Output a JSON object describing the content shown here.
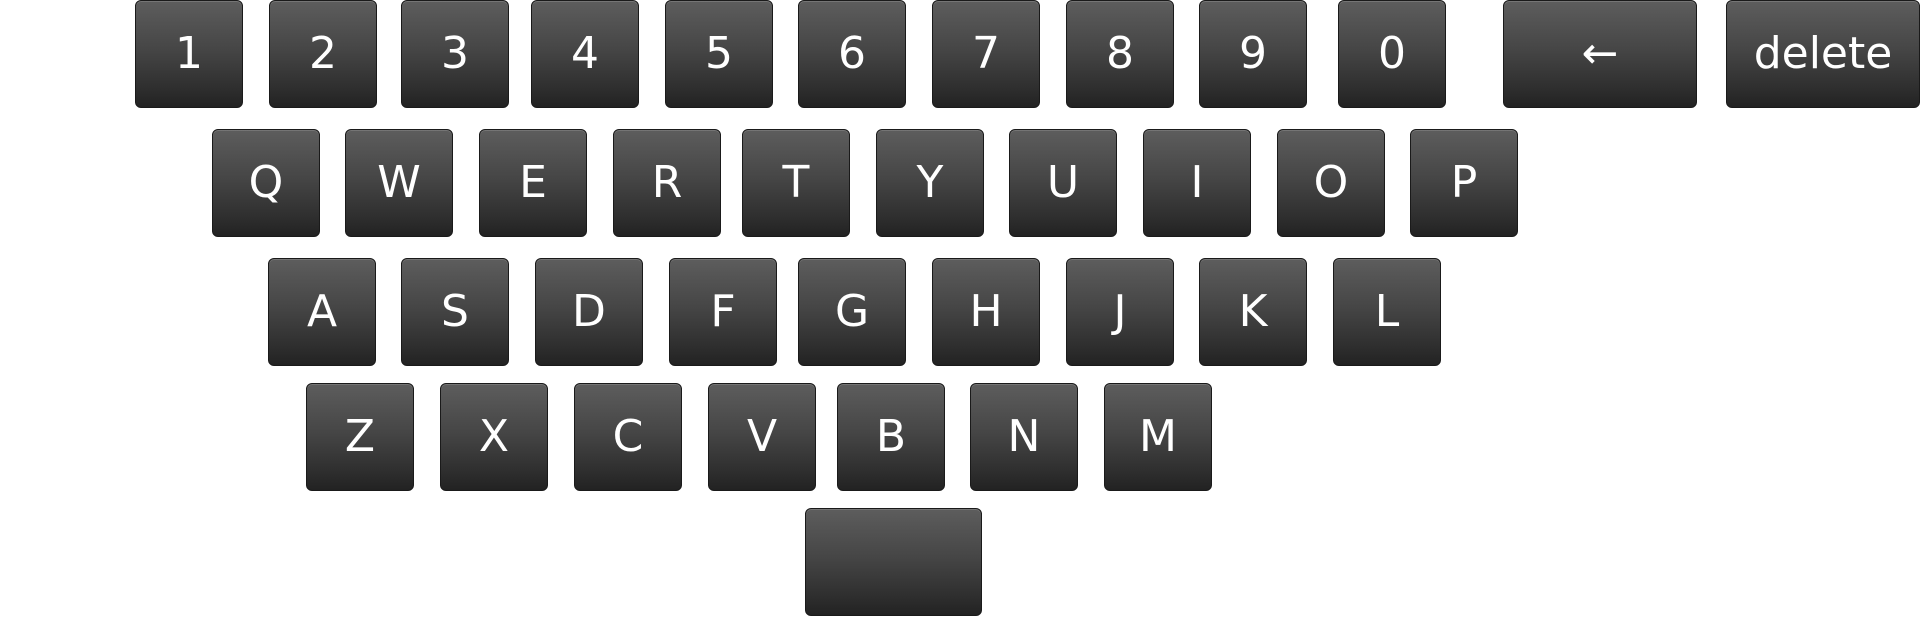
{
  "keyboard": {
    "row_numbers": [
      "1",
      "2",
      "3",
      "4",
      "5",
      "6",
      "7",
      "8",
      "9",
      "0"
    ],
    "backspace_label": "←",
    "delete_label": "delete",
    "row_qwerty": [
      "Q",
      "W",
      "E",
      "R",
      "T",
      "Y",
      "U",
      "I",
      "O",
      "P"
    ],
    "row_home": [
      "A",
      "S",
      "D",
      "F",
      "G",
      "H",
      "J",
      "K",
      "L"
    ],
    "row_bottom": [
      "Z",
      "X",
      "C",
      "V",
      "B",
      "N",
      "M"
    ],
    "space_label": ""
  },
  "colors": {
    "key_top": "#5d5d5d",
    "key_bottom": "#222222",
    "key_text": "#ffffff",
    "background": "#ffffff"
  }
}
